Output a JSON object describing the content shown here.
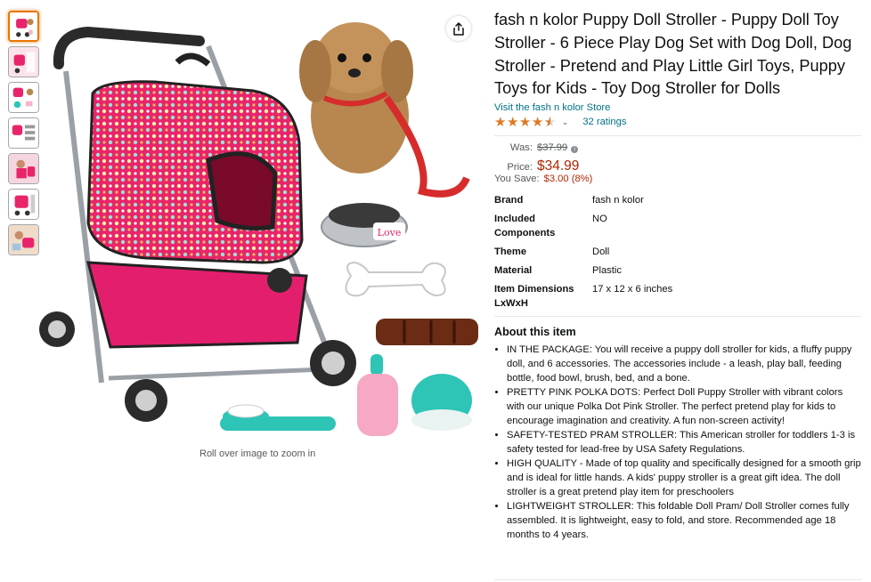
{
  "product": {
    "title": "fash n kolor Puppy Doll Stroller - Puppy Doll Toy Stroller - 6 Piece Play Dog Set with Dog Doll, Dog Stroller - Pretend and Play Little Girl Toys, Puppy Toys for Kids - Toy Dog Stroller for Dolls",
    "store_link": "Visit the fash n kolor Store",
    "ratings_count": "32 ratings",
    "star_rating": 4.5
  },
  "price": {
    "was_label": "Was:",
    "was_value": "$37.99",
    "price_label": "Price:",
    "price_value": "$34.99",
    "save_label": "You Save:",
    "save_value": "$3.00 (8%)"
  },
  "specs": [
    {
      "key": "Brand",
      "value": "fash n kolor"
    },
    {
      "key": "Included Components",
      "value": "NO"
    },
    {
      "key": "Theme",
      "value": "Doll"
    },
    {
      "key": "Material",
      "value": "Plastic"
    },
    {
      "key": "Item Dimensions LxWxH",
      "value": "17 x 12 x 6 inches"
    }
  ],
  "about": {
    "title": "About this item",
    "bullets": [
      "IN THE PACKAGE: You will receive a puppy doll stroller for kids, a fluffy puppy doll, and 6 accessories. The accessories include - a leash, play ball, feeding bottle, food bowl, brush, bed, and a bone.",
      "PRETTY PINK POLKA DOTS: Perfect Doll Puppy Stroller with vibrant colors with our unique Polka Dot Pink Stroller. The perfect pretend play for kids to encourage imagination and creativity. A fun non-screen activity!",
      "SAFETY-TESTED PRAM STROLLER: This American stroller for toddlers 1-3 is safety tested for lead-free by USA Safety Regulations.",
      "HIGH QUALITY - Made of top quality and specifically designed for a smooth grip and is ideal for little hands. A kids' puppy stroller is a great gift idea. The doll stroller is a great pretend play item for preschoolers",
      "LIGHTWEIGHT STROLLER: This foldable Doll Pram/ Doll Stroller comes fully assembled. It is lightweight, easy to fold, and store. Recommended age 18 months to 4 years."
    ]
  },
  "gallery": {
    "zoom_hint": "Roll over image to zoom in",
    "bowl_text": "Love",
    "thumbnail_count": 7,
    "active_thumbnail": 0
  },
  "colors": {
    "accent_orange": "#e77600",
    "link": "#007185",
    "price_red": "#B12704",
    "star": "#de7921",
    "stroller_pink": "#e8246a"
  }
}
